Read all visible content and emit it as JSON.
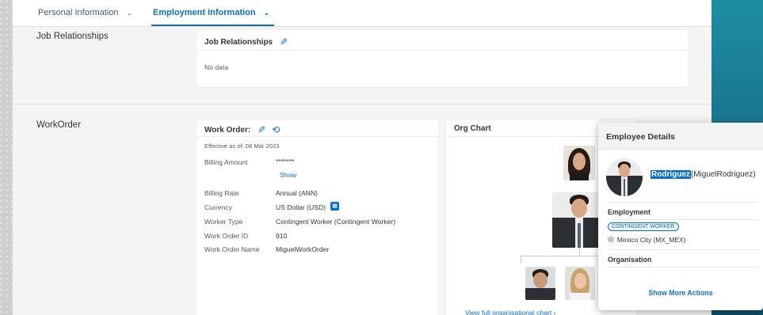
{
  "tabs": [
    {
      "label": "Personal Information"
    },
    {
      "label": "Employment Information"
    }
  ],
  "job_relationships": {
    "section_label": "Job Relationships",
    "card_title": "Job Relationships",
    "empty_text": "No data"
  },
  "workorder": {
    "section_label": "WorkOrder",
    "card_title": "Work Order:",
    "effective": "Effective as of: 08 Mar 2023",
    "fields": {
      "billing_amount_label": "Billing Amount",
      "billing_amount_value": "*******",
      "show_link": "Show",
      "billing_rate_label": "Billing Rate",
      "billing_rate_value": "Annual (ANN)",
      "currency_label": "Currency",
      "currency_value": "US Dollar (USD)",
      "worker_type_label": "Worker Type",
      "worker_type_value": "Contingent Worker (Contingent Worker)",
      "work_order_id_label": "Work Order ID",
      "work_order_id_value": "910",
      "work_order_name_label": "Work Order Name",
      "work_order_name_value": "MiguelWorkOrder"
    }
  },
  "org_chart": {
    "title": "Org Chart",
    "footer_link": "View full organisational chart",
    "footer_chevron": "›"
  },
  "employee_details": {
    "header": "Employee Details",
    "name_highlight": "Rodriguez",
    "name_rest": "(MiguelRodriguez)",
    "employment_label": "Employment",
    "badge": "CONTINGENT WORKER",
    "location": "Mexico City (MX_MEX)",
    "organisation_label": "Organisation",
    "action": "Show More Actions"
  },
  "colors": {
    "accent": "#0a6ed1",
    "teal_panel": "#176b85",
    "highlight": "#0a6ed1"
  },
  "icons": {
    "edit": "pencil-icon",
    "history": "history-icon",
    "currency": "currency-icon",
    "location": "location-pin-icon",
    "chevron": "chevron-down-icon"
  }
}
